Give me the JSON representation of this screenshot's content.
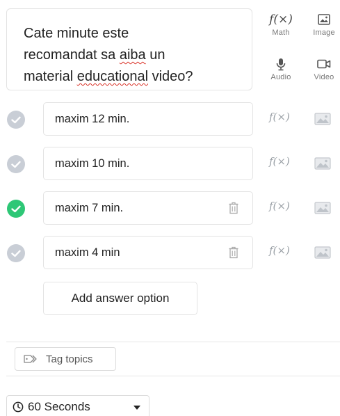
{
  "question": {
    "line1": "Cate minute este",
    "line2_pre": "recomandat sa ",
    "line2_spell": "aiba",
    "line2_post": " un",
    "line3_pre": "material ",
    "line3_spell": "educational",
    "line3_post": " video?"
  },
  "media": {
    "math_label": "Math",
    "image_label": "Image",
    "audio_label": "Audio",
    "video_label": "Video",
    "math_glyph": "f(×)"
  },
  "options": [
    {
      "text": "maxim 12 min.",
      "correct": false,
      "icon": "check-icon"
    },
    {
      "text": "maxim 10 min.",
      "correct": false,
      "icon": "check-icon"
    },
    {
      "text": "maxim 7 min.",
      "correct": true,
      "icon": "check-icon"
    },
    {
      "text": "maxim 4 min",
      "correct": false,
      "icon": "check-icon"
    }
  ],
  "row_fx_glyph": "f(×)",
  "add_option_label": "Add answer option",
  "tag_topics_label": "Tag topics",
  "timer_label": "60 Seconds",
  "colors": {
    "correct": "#2ec776",
    "unselected": "#c9ced6"
  }
}
